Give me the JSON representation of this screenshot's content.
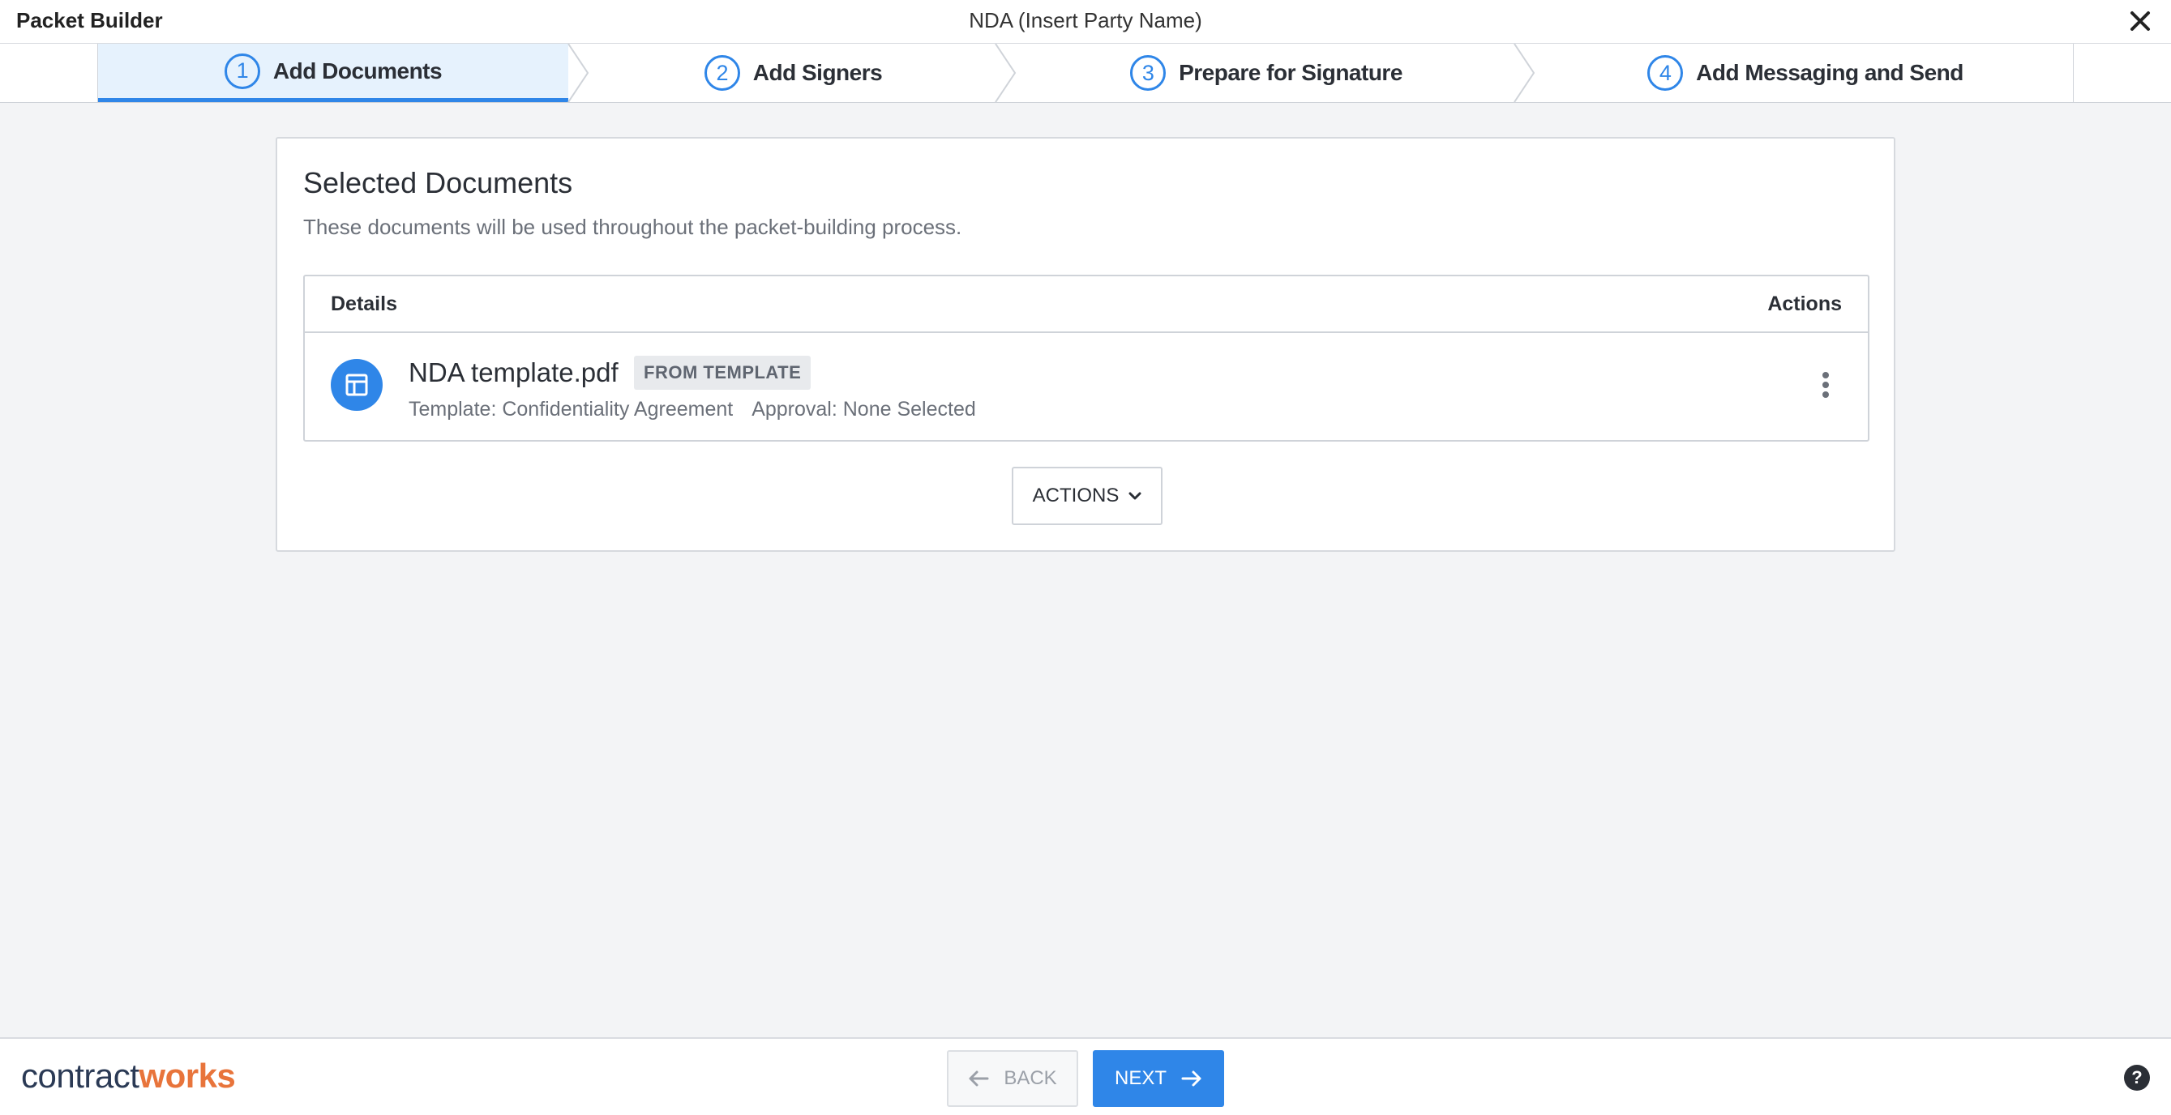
{
  "header": {
    "app_title": "Packet Builder",
    "doc_title": "NDA (Insert Party Name)",
    "close_icon": "close-icon"
  },
  "stepper": {
    "steps": [
      {
        "number": "1",
        "label": "Add Documents",
        "active": true
      },
      {
        "number": "2",
        "label": "Add Signers",
        "active": false
      },
      {
        "number": "3",
        "label": "Prepare for Signature",
        "active": false
      },
      {
        "number": "4",
        "label": "Add Messaging and Send",
        "active": false
      }
    ],
    "accent_color": "#2f86e8"
  },
  "card": {
    "title": "Selected Documents",
    "subtitle": "These documents will be used throughout the packet-building process.",
    "table": {
      "columns": [
        "Details",
        "Actions"
      ],
      "rows": [
        {
          "name": "NDA template.pdf",
          "badge": "FROM TEMPLATE",
          "template": "Template: Confidentiality Agreement",
          "approval": "Approval: None Selected",
          "icon": "template-icon"
        }
      ]
    },
    "actions_label": "ACTIONS"
  },
  "footer": {
    "logo_part1": "contract",
    "logo_part2": "works",
    "back_label": "BACK",
    "next_label": "NEXT",
    "help_label": "?"
  }
}
